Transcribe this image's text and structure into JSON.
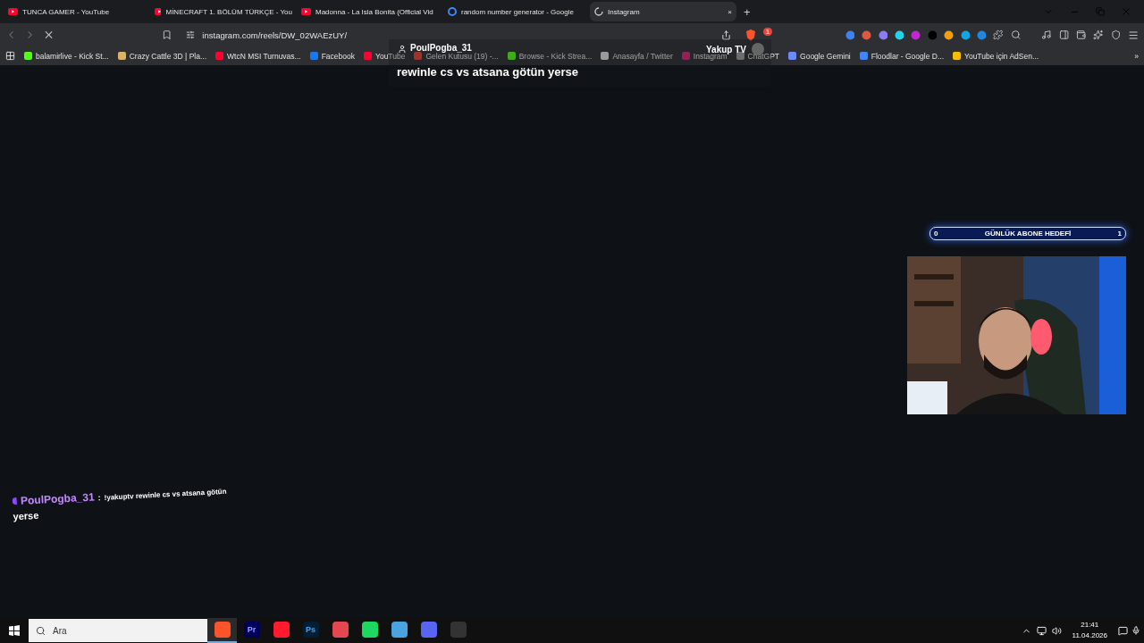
{
  "tabs": [
    {
      "title": "TUNCA GAMER - YouTube",
      "kind": "youtube",
      "selected": false
    },
    {
      "title": "MİNECRAFT 1. BÖLÜM TÜRKÇE - You",
      "kind": "youtube",
      "selected": false
    },
    {
      "title": "Madonna - La Isla Bonita (Official Vid",
      "kind": "youtube",
      "selected": false
    },
    {
      "title": "random number generator - Google",
      "kind": "google",
      "selected": false
    },
    {
      "title": "Instagram",
      "kind": "loading",
      "selected": true,
      "close": "×"
    }
  ],
  "new_tab": "+",
  "address": "instagram.com/reels/DW_02WAEzUY/",
  "shield_badge": "1",
  "bookmarks": [
    {
      "label": "balamirlive - Kick St...",
      "kind": "kick"
    },
    {
      "label": "Crazy Cattle 3D | Pla...",
      "kind": "game"
    },
    {
      "label": "WtcN MSI Turnuvas...",
      "kind": "youtube"
    },
    {
      "label": "Facebook",
      "kind": "facebook"
    },
    {
      "label": "YouTube",
      "kind": "youtube"
    },
    {
      "label": "Gelen Kutusu (19) -...",
      "kind": "gmail"
    },
    {
      "label": "Browse - Kick Strea...",
      "kind": "kick"
    },
    {
      "label": "Anasayfa / Twitter",
      "kind": "x"
    },
    {
      "label": "Instagram",
      "kind": "instagram"
    },
    {
      "label": "ChatGPT",
      "kind": "chatgpt"
    },
    {
      "label": "Google Gemini",
      "kind": "gemini"
    },
    {
      "label": "Floodlar - Google D...",
      "kind": "docs"
    },
    {
      "label": "YouTube için AdSen...",
      "kind": "adsense"
    }
  ],
  "bookmarks_more": "»",
  "stream_alert": {
    "user": "PoulPogba_31",
    "channel": "Yakup TV",
    "message": "rewinle cs vs atsana götün yerse"
  },
  "goal": {
    "start": "0",
    "label": "GÜNLÜK ABONE HEDEFİ",
    "end": "1"
  },
  "chat": {
    "user": "PoulPogba_31",
    "separator": ":",
    "message": "!yakuptv rewinle cs vs atsana götün",
    "continuation": "yerse"
  },
  "taskbar": {
    "search_placeholder": "Ara",
    "apps": [
      {
        "kind": "brave",
        "active": true
      },
      {
        "kind": "premiere",
        "label": "Pr",
        "active": false
      },
      {
        "kind": "opera",
        "active": false
      },
      {
        "kind": "photoshop",
        "label": "Ps",
        "active": false
      },
      {
        "kind": "creative",
        "active": false
      },
      {
        "kind": "spotify",
        "active": false
      },
      {
        "kind": "tool",
        "active": false
      },
      {
        "kind": "discord",
        "active": false
      },
      {
        "kind": "obs",
        "active": false
      }
    ],
    "time": "21:41",
    "date": "11.04.2026"
  }
}
